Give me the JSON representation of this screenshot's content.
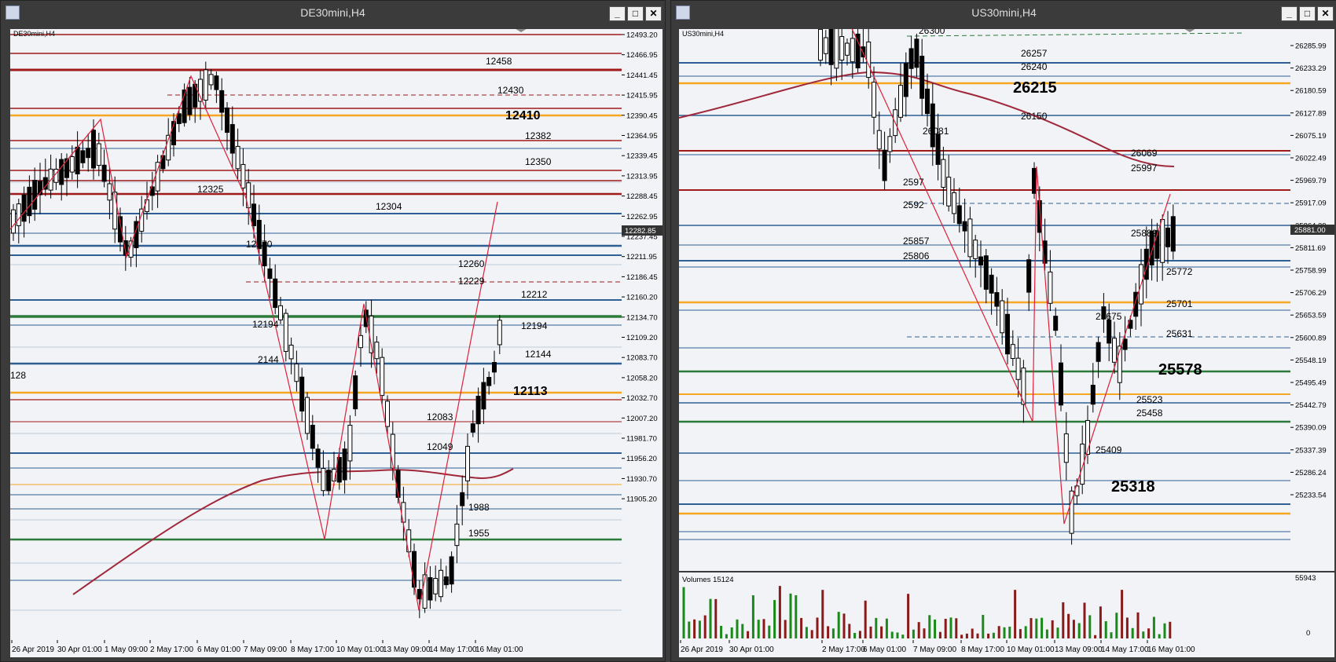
{
  "left": {
    "window_title": "DE30mini,H4",
    "chart_label": "DE30mini,H4",
    "price_ticks": [
      "12493.20",
      "12466.95",
      "12441.45",
      "12415.95",
      "12390.45",
      "12364.95",
      "12339.45",
      "12313.95",
      "12288.45",
      "12262.95",
      "12237.45",
      "12211.95",
      "12186.45",
      "12160.20",
      "12134.70",
      "12109.20",
      "12083.70",
      "12058.20",
      "12032.70",
      "12007.20",
      "11981.70",
      "11956.20",
      "11930.70",
      "11905.20"
    ],
    "current_price": "12282.85",
    "time_ticks": [
      "26 Apr 2019",
      "30 Apr 01:00",
      "1 May 09:00",
      "2 May 17:00",
      "6 May 01:00",
      "7 May 09:00",
      "8 May 17:00",
      "10 May 01:00",
      "13 May 09:00",
      "14 May 17:00",
      "16 May 01:00"
    ],
    "level_labels": [
      {
        "text": "12458",
        "size": "small"
      },
      {
        "text": "12430",
        "size": "small"
      },
      {
        "text": "12410",
        "size": "big"
      },
      {
        "text": "12382",
        "size": "small"
      },
      {
        "text": "12350",
        "size": "small"
      },
      {
        "text": "12325",
        "size": "small"
      },
      {
        "text": "12304",
        "size": "small"
      },
      {
        "text": "12270",
        "size": "small"
      },
      {
        "text": "12260",
        "size": "small"
      },
      {
        "text": "12229",
        "size": "small"
      },
      {
        "text": "12212",
        "size": "small"
      },
      {
        "text": "12194",
        "size": "small"
      },
      {
        "text": "12194",
        "size": "small"
      },
      {
        "text": "12144",
        "size": "small"
      },
      {
        "text": "2144",
        "size": "small"
      },
      {
        "text": "128",
        "size": "small"
      },
      {
        "text": "12113",
        "size": "big"
      },
      {
        "text": "12083",
        "size": "small"
      },
      {
        "text": "12049",
        "size": "small"
      },
      {
        "text": "1988",
        "size": "small"
      },
      {
        "text": "1955",
        "size": "small"
      }
    ]
  },
  "right": {
    "window_title": "US30mini,H4",
    "chart_label": "US30mini,H4",
    "price_ticks": [
      "26285.99",
      "26233.29",
      "26180.59",
      "26127.89",
      "26075.19",
      "26022.49",
      "25969.79",
      "25917.09",
      "25864.39",
      "25811.69",
      "25758.99",
      "25706.29",
      "25653.59",
      "25600.89",
      "25548.19",
      "25495.49",
      "25442.79",
      "25390.09",
      "25337.39",
      "25286.24",
      "25233.54"
    ],
    "current_price": "25881.00",
    "time_ticks": [
      "26 Apr 2019",
      "30 Apr 01:00",
      "2 May 17:00",
      "6 May 01:00",
      "7 May 09:00",
      "8 May 17:00",
      "10 May 01:00",
      "13 May 09:00",
      "14 May 17:00",
      "16 May 01:00"
    ],
    "volumes_label": "Volumes 15124",
    "volume_scale_max": "55943",
    "volume_scale_min": "0",
    "level_labels": [
      {
        "text": "26300",
        "size": "small"
      },
      {
        "text": "26257",
        "size": "small"
      },
      {
        "text": "26240",
        "size": "small"
      },
      {
        "text": "26215",
        "size": "big"
      },
      {
        "text": "26150",
        "size": "small"
      },
      {
        "text": "26081",
        "size": "small"
      },
      {
        "text": "26069",
        "size": "small"
      },
      {
        "text": "25997",
        "size": "small"
      },
      {
        "text": "2597",
        "size": "small"
      },
      {
        "text": "2592",
        "size": "small"
      },
      {
        "text": "25889",
        "size": "small"
      },
      {
        "text": "25857",
        "size": "small"
      },
      {
        "text": "25806",
        "size": "small"
      },
      {
        "text": "25772",
        "size": "small"
      },
      {
        "text": "25701",
        "size": "small"
      },
      {
        "text": "25675",
        "size": "small"
      },
      {
        "text": "25631",
        "size": "small"
      },
      {
        "text": "25578",
        "size": "big"
      },
      {
        "text": "25523",
        "size": "small"
      },
      {
        "text": "25458",
        "size": "small"
      },
      {
        "text": "25409",
        "size": "small"
      },
      {
        "text": "25318",
        "size": "big"
      }
    ]
  },
  "colors": {
    "red_level": "#a01a1a",
    "blue_level": "#2e5f95",
    "orange_level": "#f5a623",
    "green_level": "#2a7a3a",
    "zigzag": "#e0203a",
    "moving_average": "#a0283a",
    "volume_up": "#1a8a1a",
    "volume_down": "#8a1a1a",
    "plot_background": "#f1f3f6"
  },
  "buttons": {
    "minimize": "_",
    "maximize": "□",
    "close": "✕"
  }
}
